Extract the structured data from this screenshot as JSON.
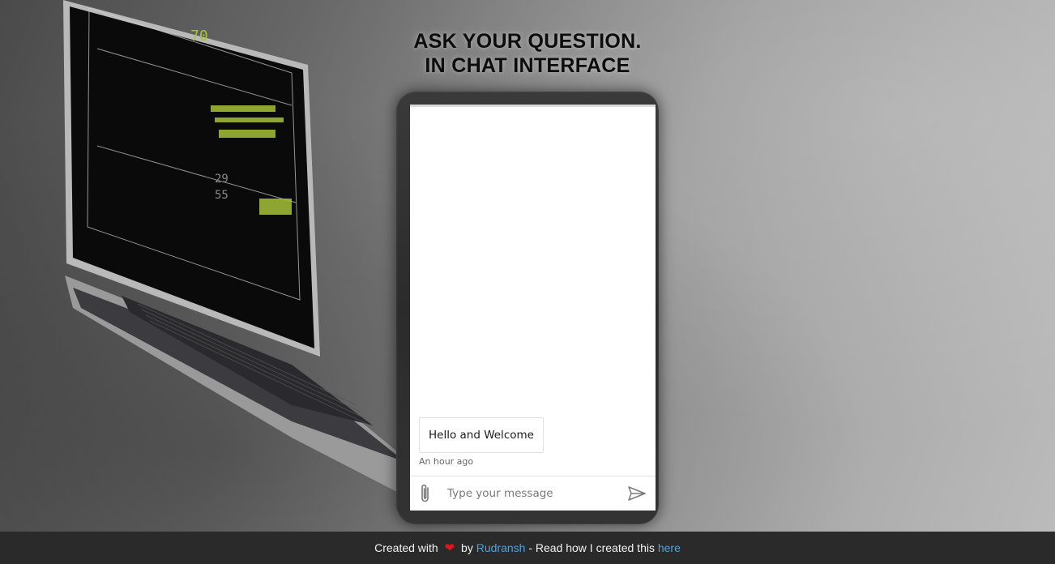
{
  "headline": {
    "line1": "ASK YOUR QUESTION.",
    "line2": "IN CHAT INTERFACE"
  },
  "chat": {
    "messages": [
      {
        "text": "Hello and Welcome",
        "time": "An hour ago"
      }
    ],
    "input_placeholder": "Type your message",
    "input_value": "",
    "attach_icon": "paperclip-icon",
    "send_icon": "send-icon"
  },
  "footer": {
    "prefix": "Created with",
    "heart_icon": "heart-icon",
    "by": "by",
    "author": "Rudransh",
    "middle": "- Read how I created this",
    "link": "here"
  },
  "colors": {
    "footer_bg": "#2a2a2a",
    "link": "#4aa3df",
    "heart": "#e0161b"
  }
}
